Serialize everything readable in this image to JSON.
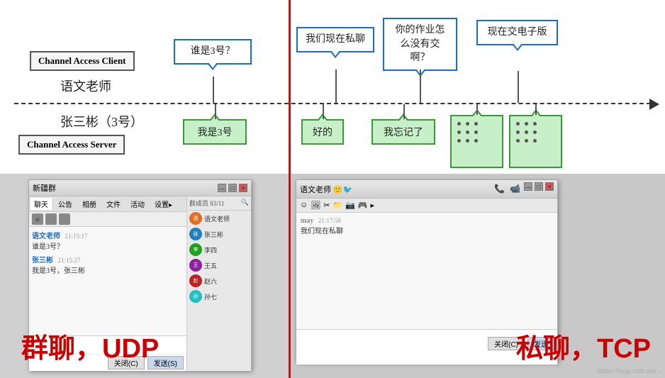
{
  "diagram": {
    "client_label": "Channel Access Client",
    "server_label": "Channel Access Server",
    "teacher_label": "语文老师",
    "student_label": "张三彬（3号）",
    "bubbles": {
      "who_is_3": "谁是3号？",
      "we_are_private": "我们现在私聊",
      "why_no_homework": "你的作业怎么没有交啊？",
      "submit_electronic": "现在交电子版",
      "i_am_3": "我是3号",
      "ok": "好的",
      "i_forgot": "我忘记了"
    }
  },
  "bottom": {
    "group_label": "群聊，UDP",
    "private_label": "私聊，TCP",
    "group_chat": {
      "window_title": "新疆群",
      "tabs": [
        "聊天",
        "公告",
        "相册",
        "文件",
        "活动",
        "设置"
      ],
      "member_count": "群成员 83/11",
      "messages": [
        {
          "sender": "语文老师",
          "time": "21:15:17",
          "content": "谁是3号？"
        },
        {
          "sender": "张三彬",
          "time": "21:15:27",
          "content": "我是3号，张三彬"
        }
      ],
      "close_btn": "关闭(C)",
      "send_btn": "发送(S)"
    },
    "private_chat": {
      "window_title": "语文老师🙂🐦",
      "messages": [
        {
          "sender": "may",
          "time": "21:17:58",
          "content": "我们现在私聊"
        }
      ],
      "close_btn": "关闭(C)",
      "send_btn": "发送"
    }
  },
  "watermark": "https://blog.csdn.net/..."
}
